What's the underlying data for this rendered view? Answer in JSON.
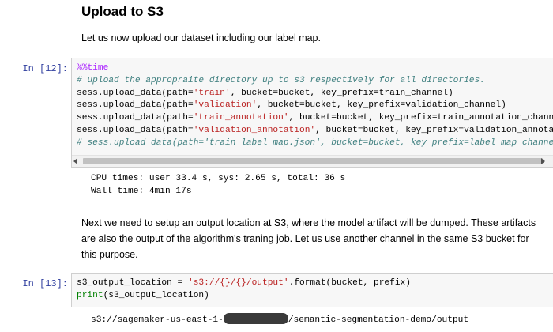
{
  "markdown1": {
    "title": "Upload to S3",
    "text": "Let us now upload our dataset including our label map."
  },
  "cell12": {
    "prompt": "In [12]:",
    "lines": [
      [
        {
          "t": "%%",
          "c": "op"
        },
        {
          "t": "time",
          "c": "magic"
        }
      ],
      [
        {
          "t": "# upload the appropraite directory up to s3 respectively for all directories.",
          "c": "comment"
        }
      ],
      [
        {
          "t": "sess.upload_data(path="
        },
        {
          "t": "'train'",
          "c": "string"
        },
        {
          "t": ", bucket=bucket, key_prefix=train_channel)"
        }
      ],
      [
        {
          "t": "sess.upload_data(path="
        },
        {
          "t": "'validation'",
          "c": "string"
        },
        {
          "t": ", bucket=bucket, key_prefix=validation_channel)"
        }
      ],
      [
        {
          "t": "sess.upload_data(path="
        },
        {
          "t": "'train_annotation'",
          "c": "string"
        },
        {
          "t": ", bucket=bucket, key_prefix=train_annotation_channel)"
        }
      ],
      [
        {
          "t": "sess.upload_data(path="
        },
        {
          "t": "'validation_annotation'",
          "c": "string"
        },
        {
          "t": ", bucket=bucket, key_prefix=validation_annotation_channel)"
        }
      ],
      [
        {
          "t": "# sess.upload_data(path='train_label_map.json', bucket=bucket, key_prefix=label_map_channel)",
          "c": "comment"
        }
      ]
    ],
    "output": [
      "CPU times: user 33.4 s, sys: 2.65 s, total: 36 s",
      "Wall time: 4min 17s"
    ]
  },
  "markdown2": {
    "text": "Next we need to setup an output location at S3, where the model artifact will be dumped. These artifacts are also the output of the algorithm's traning job. Let us use another channel in the same S3 bucket for this purpose."
  },
  "cell13": {
    "prompt": "In [13]:",
    "lines": [
      [
        {
          "t": "s3_output_location = "
        },
        {
          "t": "'s3://{}/{}/output'",
          "c": "string"
        },
        {
          "t": ".format(bucket, prefix)"
        }
      ],
      [
        {
          "t": "print",
          "c": "builtin"
        },
        {
          "t": "(s3_output_location)"
        }
      ]
    ],
    "output_prefix": "s3://sagemaker-us-east-1-",
    "output_suffix": "/semantic-segmentation-demo/output"
  }
}
